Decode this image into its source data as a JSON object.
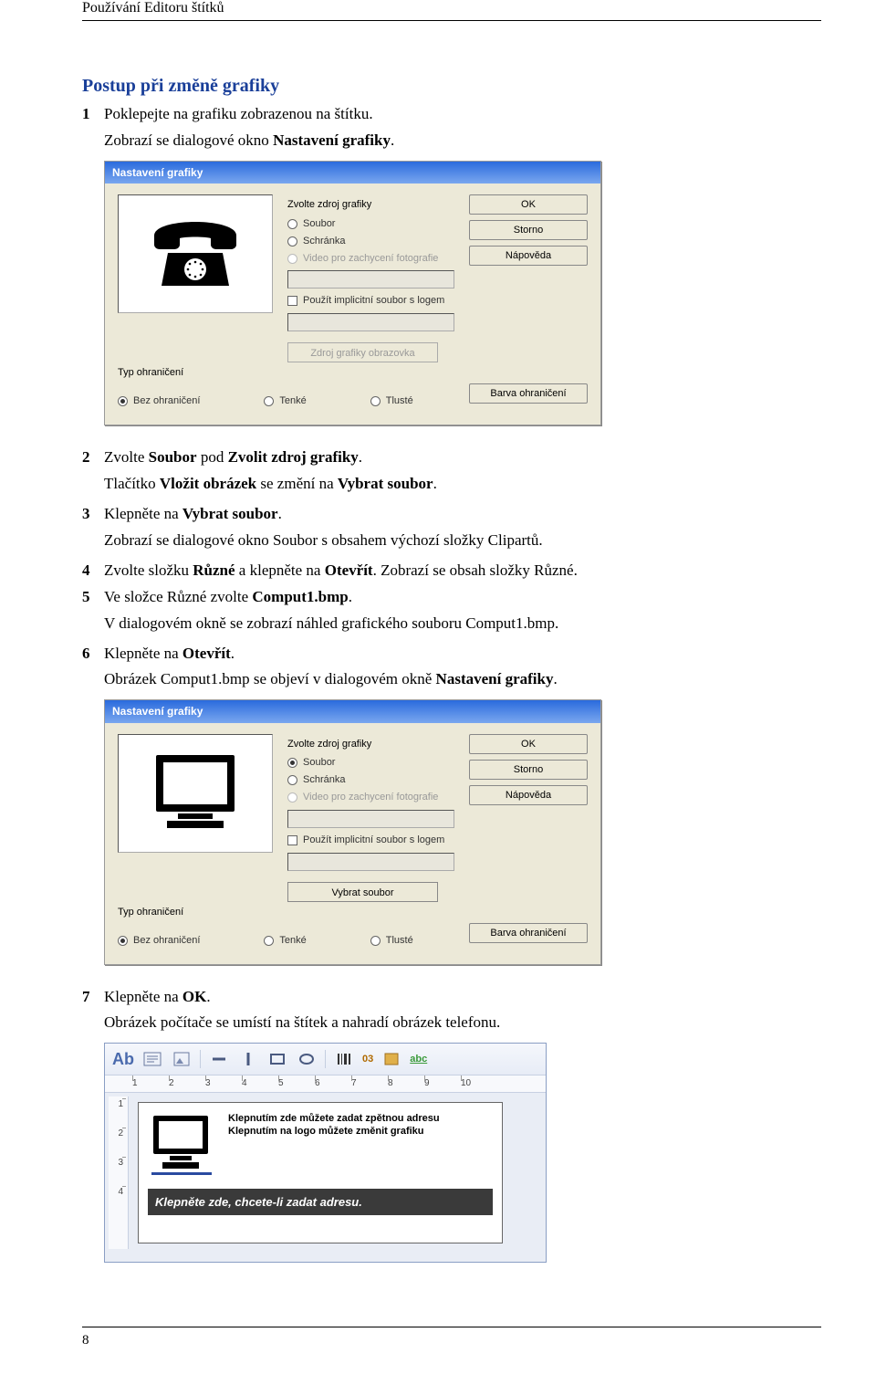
{
  "header": {
    "running_head": "Používání Editoru štítků"
  },
  "section": {
    "title": "Postup při změně grafiky"
  },
  "steps": {
    "s1": {
      "num": "1",
      "text_a": "Poklepejte na grafiku zobrazenou na štítku.",
      "text_b": "Zobrazí se dialogové okno ",
      "text_b_bold": "Nastavení grafiky",
      "text_b_end": "."
    },
    "s2": {
      "num": "2",
      "text_a": "Zvolte ",
      "bold_a": "Soubor",
      "text_b": " pod ",
      "bold_b": "Zvolit zdroj grafiky",
      "text_c": ".",
      "sub_a": "Tlačítko ",
      "sub_bold_a": "Vložit obrázek",
      "sub_b": " se změní na ",
      "sub_bold_b": "Vybrat soubor",
      "sub_c": "."
    },
    "s3": {
      "num": "3",
      "text_a": "Klepněte na ",
      "bold_a": "Vybrat soubor",
      "text_b": ".",
      "sub": "Zobrazí se dialogové okno Soubor s obsahem výchozí složky Clipartů."
    },
    "s4": {
      "num": "4",
      "text_a": "Zvolte složku ",
      "bold_a": "Různé",
      "text_b": " a klepněte na ",
      "bold_b": "Otevřít",
      "text_c": ". Zobrazí se obsah složky Různé."
    },
    "s5": {
      "num": "5",
      "text_a": "Ve složce Různé zvolte ",
      "bold_a": "Comput1.bmp",
      "text_b": ".",
      "sub": "V dialogovém okně se zobrazí náhled grafického souboru Comput1.bmp."
    },
    "s6": {
      "num": "6",
      "text_a": "Klepněte na ",
      "bold_a": "Otevřít",
      "text_b": ".",
      "sub_a": "Obrázek Comput1.bmp se objeví v dialogovém okně ",
      "sub_bold": "Nastavení grafiky",
      "sub_b": "."
    },
    "s7": {
      "num": "7",
      "text_a": " Klepněte na ",
      "bold_a": "OK",
      "text_b": ".",
      "sub": "Obrázek počítače se umístí na štítek a nahradí obrázek telefonu."
    }
  },
  "dialog": {
    "title": "Nastavení grafiky",
    "group_label": "Zvolte zdroj grafiky",
    "opt_file": "Soubor",
    "opt_clip": "Schránka",
    "opt_capture": "Video pro zachycení fotografie",
    "chk_logo": "Použít implicitní soubor s logem",
    "btn_select_disabled": "Zdroj grafiky obrazovka",
    "btn_select_file": "Vybrat soubor",
    "btn_ok": "OK",
    "btn_cancel": "Storno",
    "btn_help": "Nápověda",
    "border_group": "Typ ohraničení",
    "border_none": "Bez ohraničení",
    "border_thin": "Tenké",
    "border_thick": "Tlusté",
    "btn_border_color": "Barva ohraničení"
  },
  "editor": {
    "tb_a": "Ab",
    "tb_barcode": "03",
    "tb_abc": "abc",
    "ruler": [
      "1",
      "2",
      "3",
      "4",
      "5",
      "6",
      "7",
      "8",
      "9",
      "10"
    ],
    "vruler": [
      "1",
      "2",
      "3",
      "4"
    ],
    "line1": "Klepnutím zde můžete zadat zpětnou adresu",
    "line2": "Klepnutím na logo můžete změnit grafiku",
    "address_bar": "Klepněte zde, chcete-li zadat adresu."
  },
  "footer": {
    "page_num": "8"
  }
}
